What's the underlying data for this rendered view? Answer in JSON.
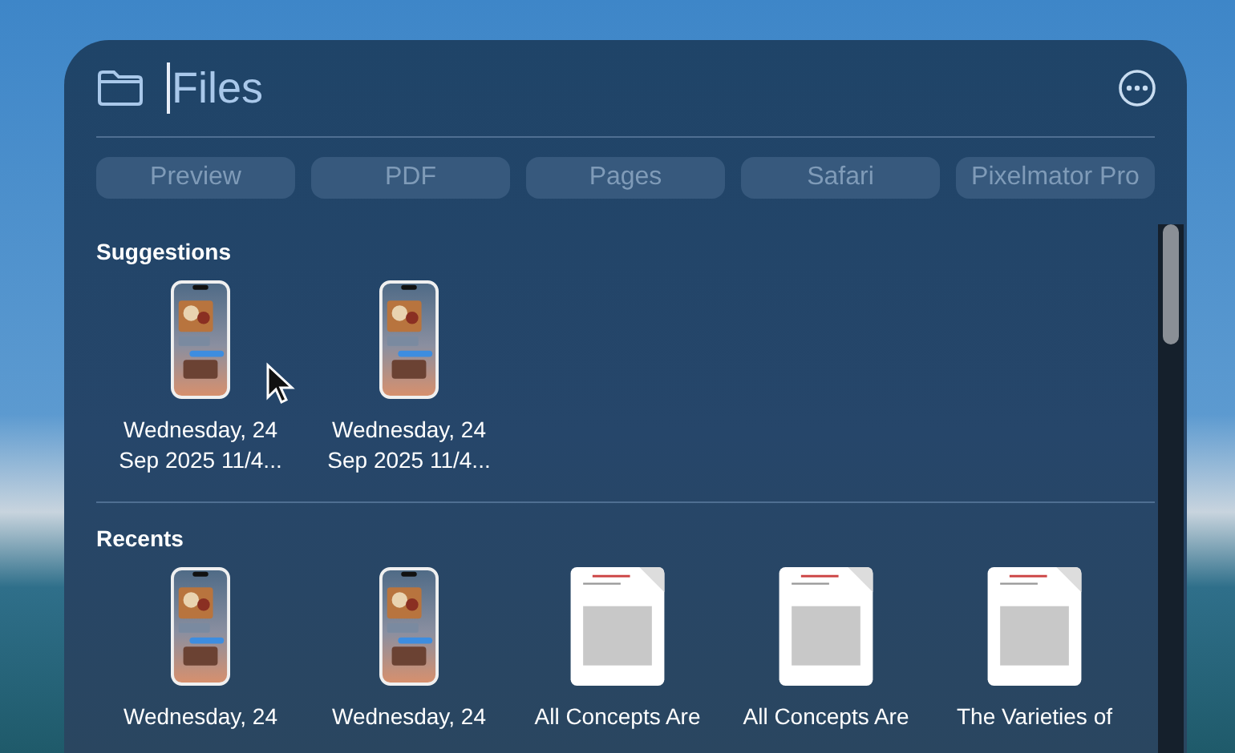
{
  "search": {
    "value": "Files"
  },
  "filters": [
    "Preview",
    "PDF",
    "Pages",
    "Safari",
    "Pixelmator Pro"
  ],
  "sections": [
    {
      "title": "Suggestions",
      "items": [
        {
          "kind": "phone",
          "label": "Wednesday, 24 Sep 2025 11/4..."
        },
        {
          "kind": "phone",
          "label": "Wednesday, 24 Sep 2025 11/4..."
        }
      ]
    },
    {
      "title": "Recents",
      "items": [
        {
          "kind": "phone",
          "label": "Wednesday, 24"
        },
        {
          "kind": "phone",
          "label": "Wednesday, 24"
        },
        {
          "kind": "document",
          "label": "All Concepts Are"
        },
        {
          "kind": "document",
          "label": "All Concepts Are"
        },
        {
          "kind": "document",
          "label": "The Varieties of"
        }
      ]
    }
  ]
}
